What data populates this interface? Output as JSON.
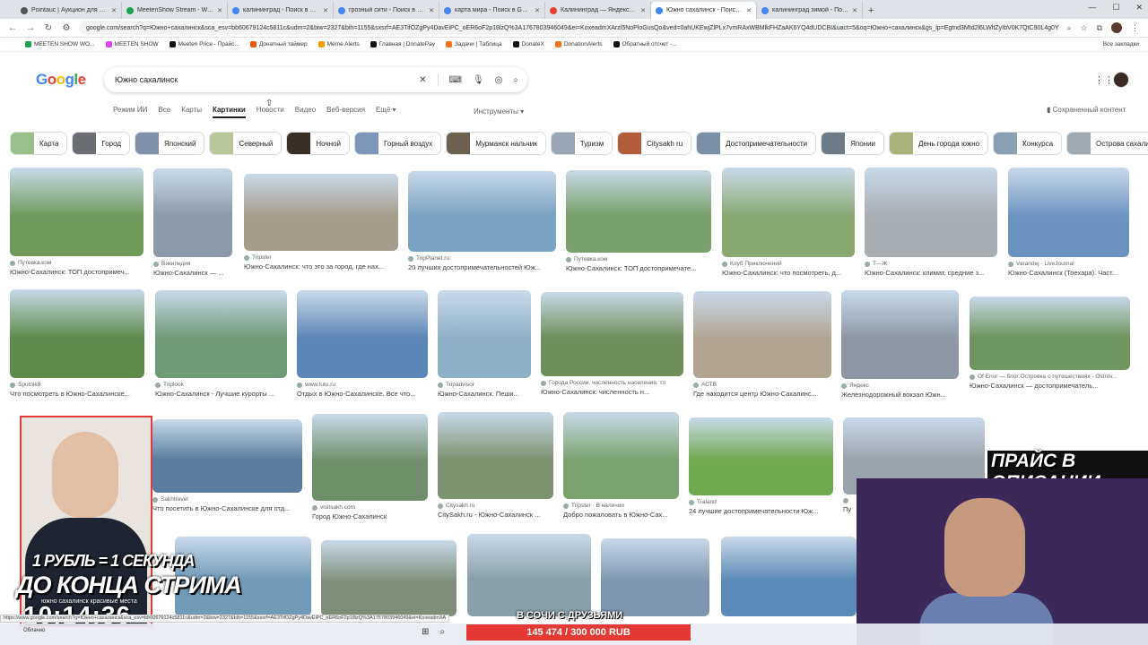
{
  "browser": {
    "tabs": [
      {
        "title": "Pointauc | Аукцион для стрима",
        "color": "#555555"
      },
      {
        "title": "MeetenShow Stream - Watch L",
        "color": "#16a34a"
      },
      {
        "title": "калининград - Поиск в Google",
        "color": "#4285f4"
      },
      {
        "title": "грозный сити - Поиск в Google",
        "color": "#4285f4"
      },
      {
        "title": "карта мира - Поиск в Google",
        "color": "#4285f4"
      },
      {
        "title": "Калининград — Яндекс Карты",
        "color": "#ea4335"
      },
      {
        "title": "Южно сахалинск - Поиск в G",
        "color": "#4285f4",
        "active": true
      },
      {
        "title": "калининград зимой - Поиск в",
        "color": "#4285f4"
      }
    ],
    "url": "google.com/search?q=Южно+сахалинск&sca_esv=bb60679124c5811c&udm=2&biw=2327&bih=1155&sxsrf=AE3TifOZgPy4DavEiPC_oER6oF2p18lzQ%3A1767803946049&ei=KoxeadmXArzl5NoPloGusQo&ved=0ahUKEwjZlPLx7vmRAxWBMlkFHZaAK6YQ4dUDCBI&uact=5&oq=Южно+сахалинск&gs_lp=Egtnd3Mtd2l6LWltZyIbV0K7QtC90L4g0YHQsN..."
  },
  "bookmarks": {
    "items": [
      "MEETEN SHOW WO...",
      "MEETEN SHOW",
      "Meeten Price - Прайс...",
      "Донатный таймер",
      "Meme Alerts",
      "Главная | DonatePay",
      "Задачи | Таблица",
      "DonateX",
      "DonationAlerts",
      "Обратный отсчет -..."
    ],
    "all": "Все закладки"
  },
  "google": {
    "logo": "Google",
    "query": "Южно сахалинск",
    "filters": [
      "Режим ИИ",
      "Все",
      "Карты",
      "Картинки",
      "Новости",
      "Видео",
      "Веб-версия",
      "Ещё ▾"
    ],
    "tools": "Инструменты ▾",
    "saved": "Сохраненный контент"
  },
  "chips": [
    "Карта",
    "Город",
    "Японский",
    "Северный",
    "Ночной",
    "Горный воздух",
    "Мурманск нальчик",
    "Туризм",
    "Citysakh ru",
    "Достопримечательности",
    "Японии",
    "День города южно",
    "Конкурса",
    "Острова сахалин"
  ],
  "images": [
    {
      "src": "Путевка.ком",
      "cap": "Южно-Сахалинск: ТОП достопримеч..."
    },
    {
      "src": "Википедия",
      "cap": "Южно-Сахалинск — ..."
    },
    {
      "src": "Tripster",
      "cap": "Южно-Сахалинск: что это за город, где нах..."
    },
    {
      "src": "TripPlanet.ru",
      "cap": "20 лучших достопримечательностей Юж..."
    },
    {
      "src": "Путевка.ком",
      "cap": "Южно-Сахалинск: ТОП достопримечате..."
    },
    {
      "src": "Клуб Приключений",
      "cap": "Южно-Сахалинск: что посмотреть, д..."
    },
    {
      "src": "Т—Ж",
      "cap": "Южно-Сахалинск: климат, средние з..."
    },
    {
      "src": "Varandej - LiveJournal",
      "cap": "Южно-Сахалинск (Тоехара). Част..."
    },
    {
      "src": "Sputnik8",
      "cap": "Что посмотреть в Южно-Сахалинске..."
    },
    {
      "src": "Triplook",
      "cap": "Южно-Сахалинск - Лучшие курорты ..."
    },
    {
      "src": "www.tutu.ru",
      "cap": "Отдых в Южно-Сахалинске. Все что..."
    },
    {
      "src": "Tripadvisor",
      "cap": "Южно-Сахалинск. Пеши..."
    },
    {
      "src": "Города России. численность населения. то",
      "cap": "Южно-Сахалинск: численность н..."
    },
    {
      "src": "АСТВ",
      "cap": "Где находится центр Южно-Сахалинс..."
    },
    {
      "src": "Яндекс",
      "cap": "Железнодорожный вокзал Южн..."
    },
    {
      "src": "Of Enor — блог Островка о путешествиях - Ostrov...",
      "cap": "Южно-Сахалинск — достопримечатель..."
    },
    {
      "src": "Sakhtravel",
      "cap": "Что посетить в Южно-Сахалинске для отд..."
    },
    {
      "src": "visitsakh.com",
      "cap": "Город Южно-Сахалинск"
    },
    {
      "src": "Citysakh.ru",
      "cap": "CitySakh.ru - Южно-Сахалинск ..."
    },
    {
      "src": "Tripster · В наличии",
      "cap": "Добро пожаловать в Южно-Сах..."
    },
    {
      "src": "Traland",
      "cap": "24 лучшие достопримечательности Юж..."
    },
    {
      "src": "",
      "cap": "Пу"
    }
  ],
  "overlay": {
    "promo_line1": "1 РУБЛЬ = 1 СЕКУНДА",
    "promo_line2": "ДО КОНЦА СТРИМА",
    "promo_sub": "южно сахалинск красивые места",
    "timer": "10:14:36",
    "price_desc": "ПРАЙС В ОПИСАНИИ",
    "sochi": "В СОЧИ С ДРУЗЬЯМИ",
    "donate": "145 474 / 300 000 RUB",
    "weather": "Облачно",
    "status_url": "https://www.google.com/search?q=Южно+сахалинск&sca_esv=bb60679124c5811c&udm=2&biw=2327&bih=1155&sxsrf=AE3TifOZgPy4DavEiPC_oER6oF2p18lzQ%3A1767803946049&ei=KoxeadmXA"
  }
}
